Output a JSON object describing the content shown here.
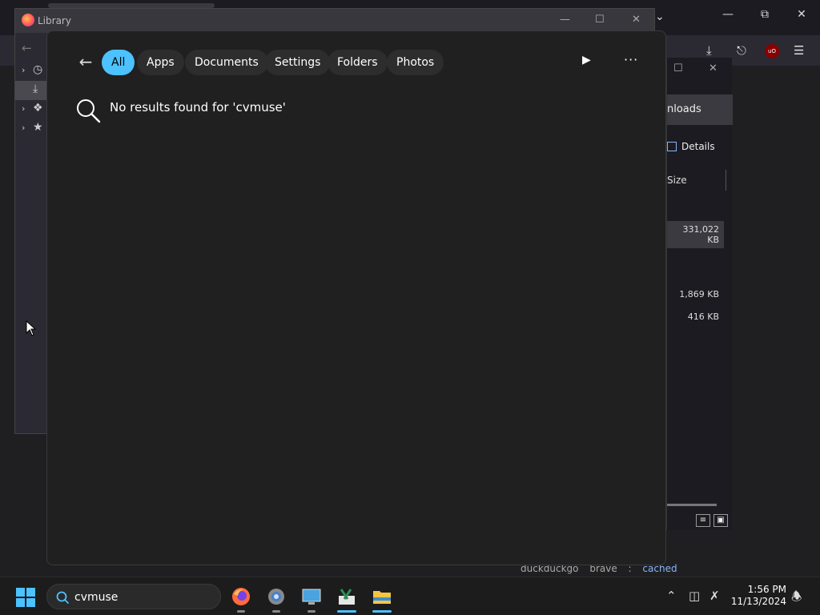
{
  "library": {
    "title": "Library"
  },
  "downloads": {
    "title_partial": "nloads",
    "details_label": "Details",
    "size_header": "Size",
    "sizes": [
      "331,022 KB",
      "1,869 KB",
      "416 KB"
    ]
  },
  "bookmarks": {
    "items": [
      "duckduckgo",
      "brave",
      ":",
      "cached"
    ]
  },
  "search_flyout": {
    "filters": [
      "All",
      "Apps",
      "Documents",
      "Settings",
      "Folders",
      "Photos"
    ],
    "active_filter": "All",
    "no_results_text": "No results found for 'cvmuse'"
  },
  "taskbar": {
    "search_value": "cvmuse",
    "time": "1:56 PM",
    "date": "11/13/2024"
  },
  "colors": {
    "accent": "#4cc2ff",
    "flyout_bg": "#202020"
  }
}
